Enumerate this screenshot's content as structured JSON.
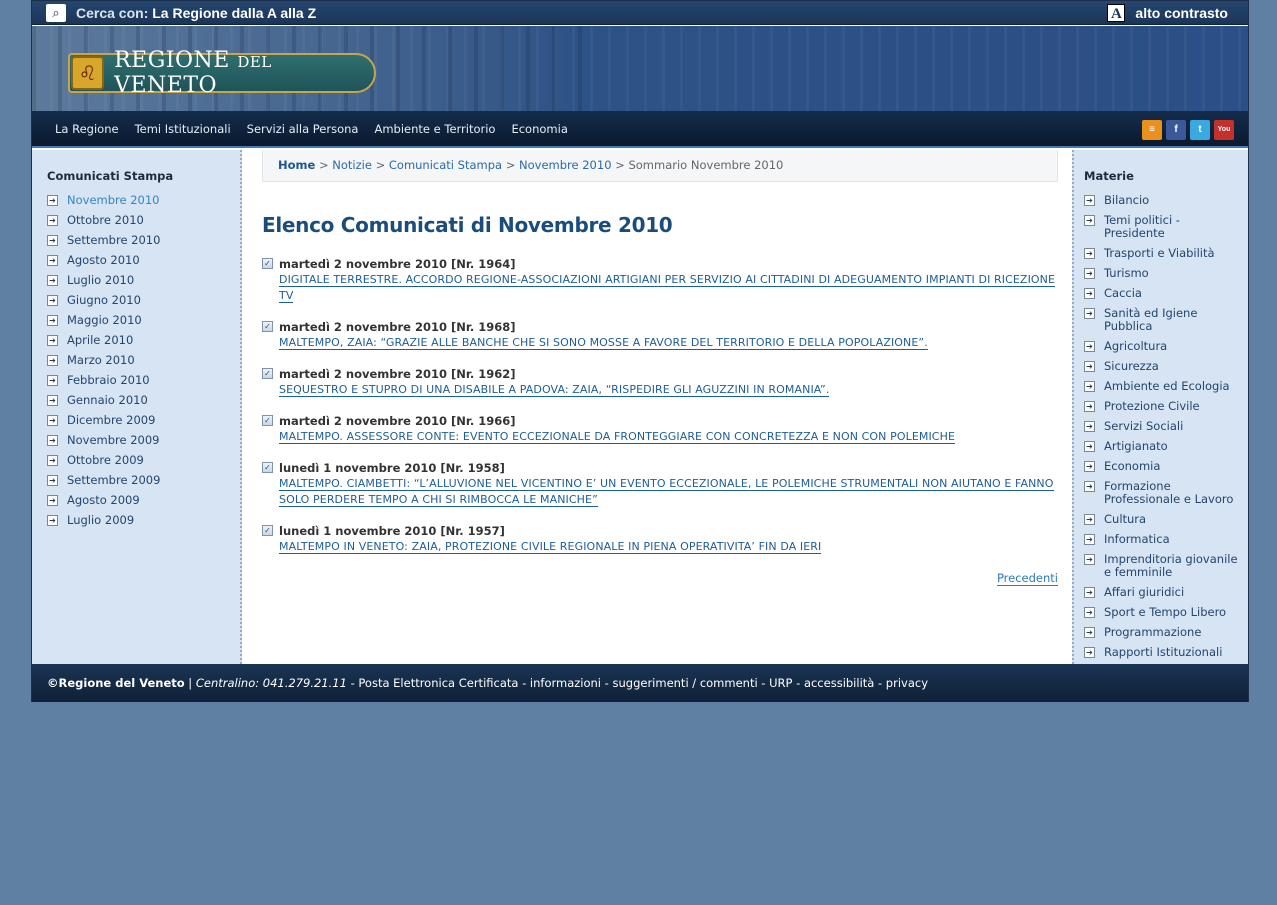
{
  "topbar": {
    "search_prefix": "Cerca con:",
    "search_link": "La Regione dalla A alla Z",
    "contrast_label": "alto contrasto"
  },
  "banner": {
    "logo_main": "REGIONE",
    "logo_small": "DEL",
    "logo_end": "VENETO"
  },
  "nav": {
    "items": [
      "La Regione",
      "Temi Istituzionali",
      "Servizi alla Persona",
      "Ambiente e Territorio",
      "Economia"
    ],
    "social": [
      {
        "icon": "rss-icon",
        "glyph": "≡",
        "color": "#e8921d"
      },
      {
        "icon": "facebook-icon",
        "glyph": "f",
        "color": "#3b5998"
      },
      {
        "icon": "twitter-icon",
        "glyph": "t",
        "color": "#39a9e0"
      },
      {
        "icon": "youtube-icon",
        "glyph": "You",
        "color": "#c4302b"
      }
    ]
  },
  "left_sidebar": {
    "title": "Comunicati Stampa",
    "items": [
      "Novembre 2010",
      "Ottobre 2010",
      "Settembre 2010",
      "Agosto 2010",
      "Luglio 2010",
      "Giugno 2010",
      "Maggio 2010",
      "Aprile 2010",
      "Marzo 2010",
      "Febbraio 2010",
      "Gennaio 2010",
      "Dicembre 2009",
      "Novembre 2009",
      "Ottobre 2009",
      "Settembre 2009",
      "Agosto 2009",
      "Luglio 2009"
    ]
  },
  "breadcrumb": {
    "home": "Home",
    "items": [
      "Notizie",
      "Comunicati Stampa",
      "Novembre 2010"
    ],
    "current": "Sommario Novembre 2010",
    "separator": ">"
  },
  "main": {
    "title": "Elenco Comunicati di Novembre 2010",
    "releases": [
      {
        "date": "martedì 2 novembre 2010 [Nr. 1964]",
        "title": "DIGITALE TERRESTRE. ACCORDO REGIONE-ASSOCIAZIONI ARTIGIANI PER SERVIZIO AI CITTADINI DI ADEGUAMENTO IMPIANTI DI RICEZIONE TV"
      },
      {
        "date": "martedì 2 novembre 2010 [Nr. 1968]",
        "title": "MALTEMPO, ZAIA: “GRAZIE ALLE BANCHE CHE SI SONO MOSSE A FAVORE DEL TERRITORIO E DELLA POPOLAZIONE”."
      },
      {
        "date": "martedì 2 novembre 2010 [Nr. 1962]",
        "title": "SEQUESTRO E STUPRO DI UNA DISABILE A PADOVA: ZAIA, “RISPEDIRE GLI AGUZZINI IN ROMANIA”."
      },
      {
        "date": "martedì 2 novembre 2010 [Nr. 1966]",
        "title": "MALTEMPO. ASSESSORE CONTE: EVENTO ECCEZIONALE DA FRONTEGGIARE CON CONCRETEZZA E NON CON POLEMICHE"
      },
      {
        "date": "lunedì 1 novembre 2010 [Nr. 1958]",
        "title": "MALTEMPO. CIAMBETTI: “L’ALLUVIONE NEL VICENTINO E’ UN EVENTO ECCEZIONALE, LE POLEMICHE STRUMENTALI NON AIUTANO E FANNO SOLO PERDERE TEMPO A CHI SI RIMBOCCA LE MANICHE”"
      },
      {
        "date": "lunedì 1 novembre 2010 [Nr. 1957]",
        "title": "MALTEMPO IN VENETO: ZAIA, PROTEZIONE CIVILE REGIONALE IN PIENA OPERATIVITA’ FIN DA IERI"
      }
    ],
    "prev_label": "Precedenti"
  },
  "right_sidebar": {
    "title": "Materie",
    "items": [
      "Bilancio",
      "Temi politici - Presidente",
      "Trasporti e Viabilità",
      "Turismo",
      "Caccia",
      "Sanità ed Igiene Pubblica",
      "Agricoltura",
      "Sicurezza",
      "Ambiente ed Ecologia",
      "Protezione Civile",
      "Servizi Sociali",
      "Artigianato",
      "Economia",
      "Formazione Professionale e Lavoro",
      "Cultura",
      "Informatica",
      "Imprenditoria giovanile e femminile",
      "Affari giuridici",
      "Sport e Tempo Libero",
      "Programmazione",
      "Rapporti Istituzionali"
    ]
  },
  "footer": {
    "copyright": "©Regione del Veneto",
    "centralino_label": "Centralino:",
    "centralino_number": "041.279.21.11",
    "links": [
      "Posta Elettronica Certificata",
      "informazioni",
      "suggerimenti / commenti",
      "URP",
      "accessibilità",
      "privacy"
    ]
  },
  "colors": {
    "page_bg": "#5f7fa3",
    "sidebar_bg": "#d6e4f3",
    "link": "#1d5d98",
    "active_link": "#3584c4"
  }
}
